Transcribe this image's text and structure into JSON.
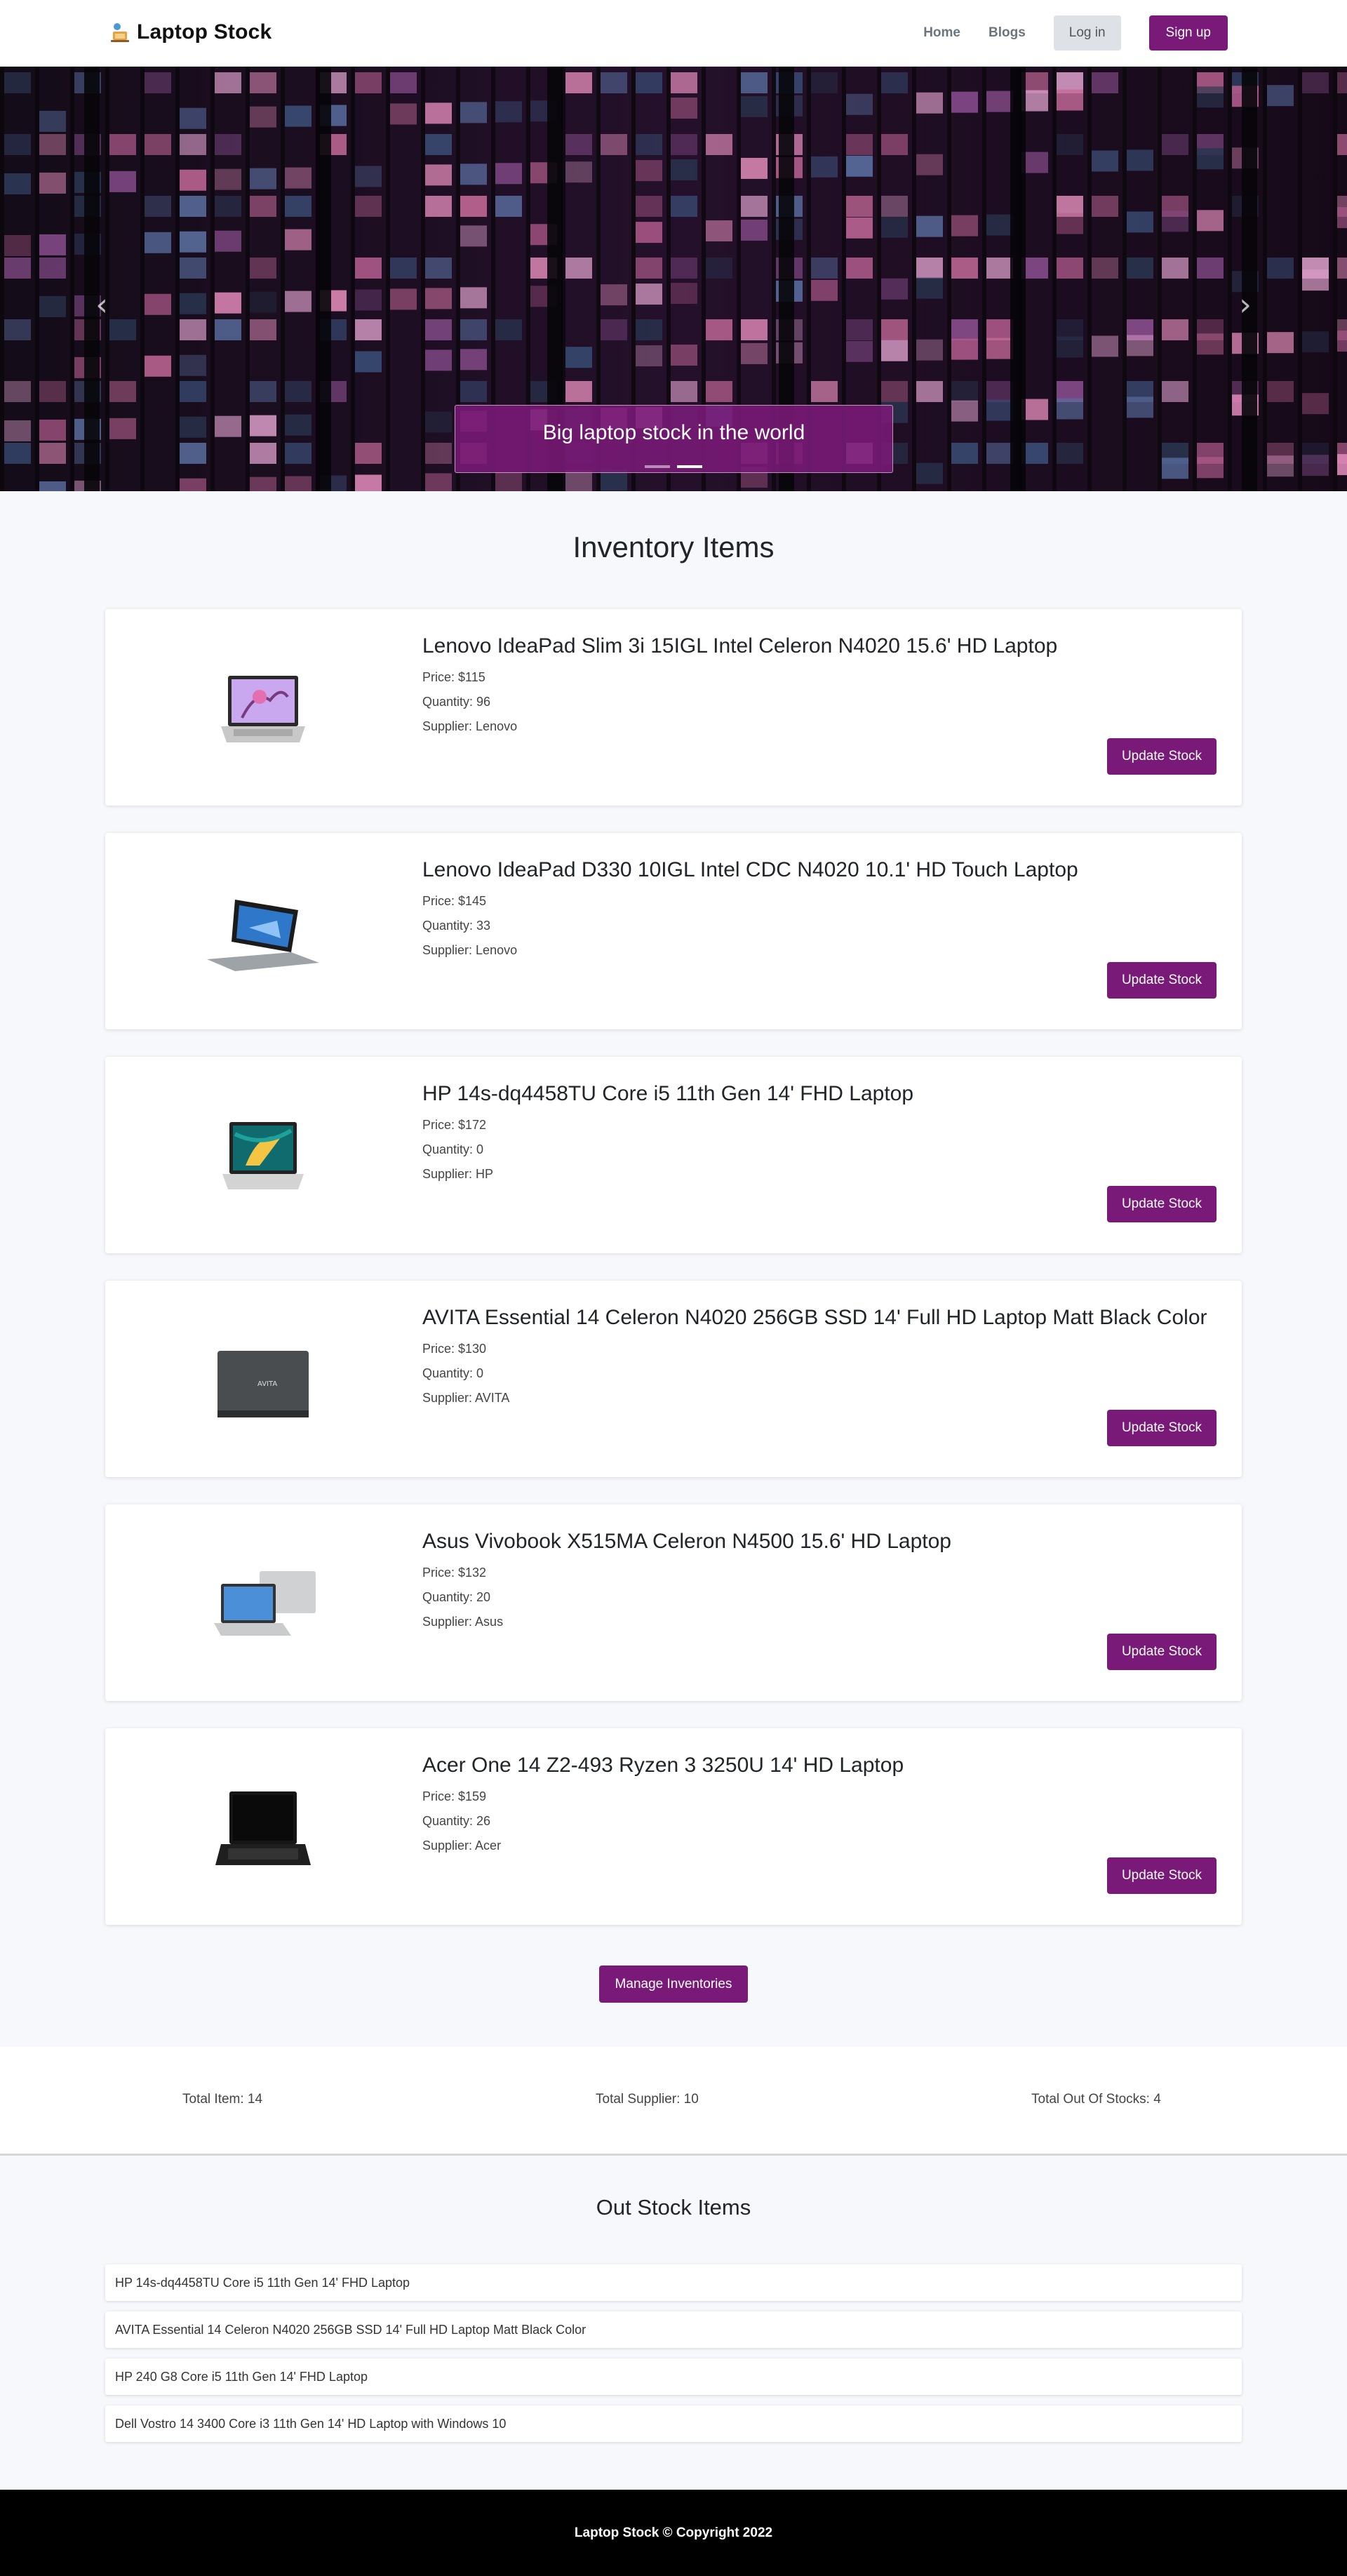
{
  "nav": {
    "brand": "Laptop Stock",
    "links": [
      "Home",
      "Blogs"
    ],
    "login": "Log in",
    "signup": "Sign up"
  },
  "hero": {
    "caption": "Big laptop stock in the world",
    "prev_icon": "‹",
    "next_icon": "›",
    "slides": 2,
    "active_slide": 2
  },
  "inventory": {
    "title": "Inventory Items",
    "update_label": "Update Stock",
    "items": [
      {
        "name": "Lenovo IdeaPad Slim 3i 15IGL Intel Celeron N4020 15.6' HD Laptop",
        "price": "Price: $115",
        "quantity": "Quantity: 96",
        "supplier": "Supplier: Lenovo",
        "image": "laptop-silver-open-icon"
      },
      {
        "name": "Lenovo IdeaPad D330 10IGL Intel CDC N4020 10.1' HD Touch Laptop",
        "price": "Price: $145",
        "quantity": "Quantity: 33",
        "supplier": "Supplier: Lenovo",
        "image": "laptop-convertible-icon"
      },
      {
        "name": "HP 14s-dq4458TU Core i5 11th Gen 14' FHD Laptop",
        "price": "Price: $172",
        "quantity": "Quantity: 0",
        "supplier": "Supplier: HP",
        "image": "laptop-teal-screen-icon"
      },
      {
        "name": "AVITA Essential 14 Celeron N4020 256GB SSD 14' Full HD Laptop Matt Black Color",
        "price": "Price: $130",
        "quantity": "Quantity: 0",
        "supplier": "Supplier: AVITA",
        "image": "laptop-closed-lid-icon"
      },
      {
        "name": "Asus Vivobook X515MA Celeron N4500 15.6' HD Laptop",
        "price": "Price: $132",
        "quantity": "Quantity: 20",
        "supplier": "Supplier: Asus",
        "image": "laptop-front-back-icon"
      },
      {
        "name": "Acer One 14 Z2-493 Ryzen 3 3250U 14' HD Laptop",
        "price": "Price: $159",
        "quantity": "Quantity: 26",
        "supplier": "Supplier: Acer",
        "image": "laptop-black-icon"
      }
    ],
    "manage_label": "Manage Inventories"
  },
  "stats": {
    "total_item": "Total Item: 14",
    "total_supplier": "Total Supplier: 10",
    "total_out": "Total Out Of Stocks: 4"
  },
  "out_stock": {
    "title": "Out Stock Items",
    "items": [
      "HP 14s-dq4458TU Core i5 11th Gen 14' FHD Laptop",
      "AVITA Essential 14 Celeron N4020 256GB SSD 14' Full HD Laptop Matt Black Color",
      "HP 240 G8 Core i5 11th Gen 14' FHD Laptop",
      "Dell Vostro 14 3400 Core i3 11th Gen 14' HD Laptop with Windows 10"
    ]
  },
  "footer": {
    "text": "Laptop Stock © Copyright 2022"
  },
  "colors": {
    "accent": "#7a1a78",
    "page_bg": "#f7f8fb",
    "footer_bg": "#000000"
  }
}
